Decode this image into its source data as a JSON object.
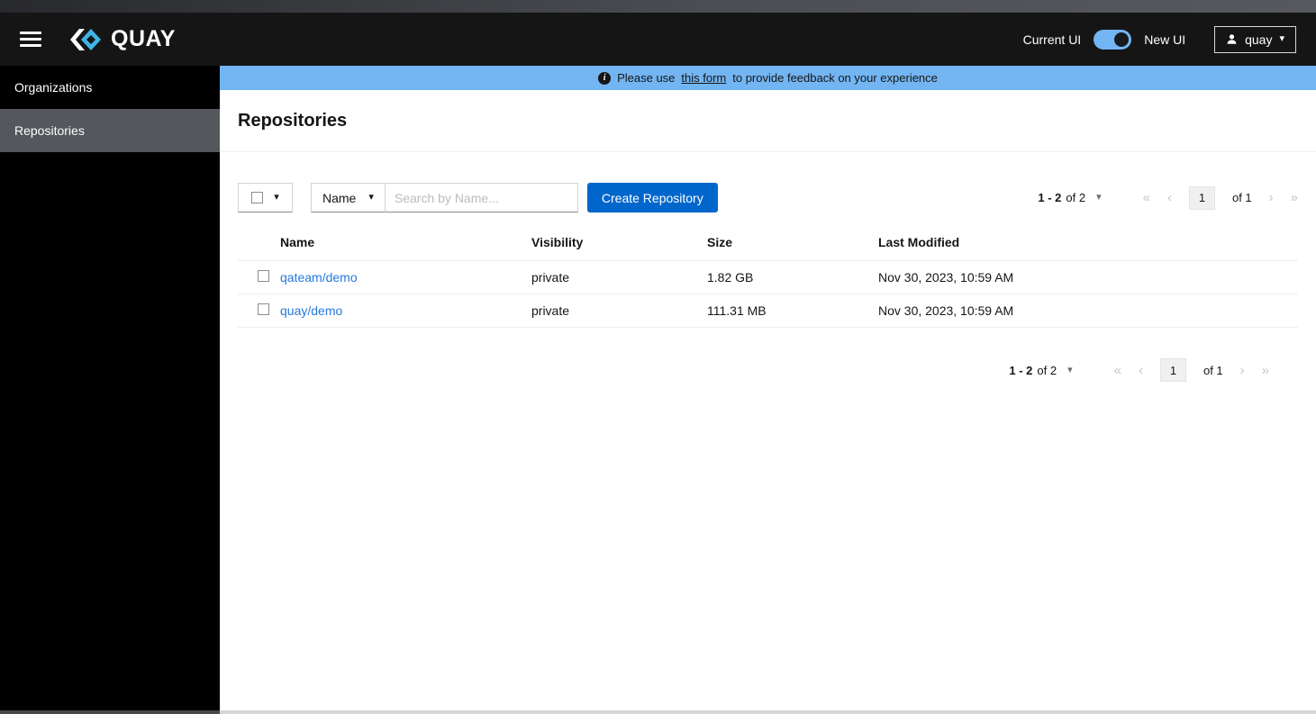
{
  "colors": {
    "accent_blue": "#0066cc",
    "banner_blue": "#73b5f2",
    "link_blue": "#2578dc",
    "masthead_bg": "#151515",
    "sidebar_active_bg": "#54575c",
    "toggle_track": "#73b5f2",
    "logo_blue": "#40b4e5"
  },
  "icons": {
    "caret_down": "▾",
    "info": "i"
  },
  "header": {
    "brand": "QUAY",
    "current_ui_label": "Current UI",
    "new_ui_label": "New UI",
    "user_name": "quay"
  },
  "sidebar": {
    "items": [
      {
        "label": "Organizations"
      },
      {
        "label": "Repositories"
      }
    ]
  },
  "banner": {
    "text_before": "Please use",
    "link_text": "this form",
    "text_after": "to provide feedback on your experience"
  },
  "page": {
    "title": "Repositories"
  },
  "toolbar": {
    "filter_label": "Name",
    "search_placeholder": "Search by Name...",
    "create_button_label": "Create Repository"
  },
  "pagination": {
    "range_current": "1 - 2",
    "range_total": "of 2",
    "page_value": "1",
    "of_pages": "of 1",
    "first_icon": "«",
    "prev_icon": "‹",
    "next_icon": "›",
    "last_icon": "»"
  },
  "table": {
    "columns": [
      "Name",
      "Visibility",
      "Size",
      "Last Modified"
    ],
    "rows": [
      {
        "name": "qateam/demo",
        "visibility": "private",
        "size": "1.82 GB",
        "last_modified": "Nov 30, 2023, 10:59 AM"
      },
      {
        "name": "quay/demo",
        "visibility": "private",
        "size": "111.31 MB",
        "last_modified": "Nov 30, 2023, 10:59 AM"
      }
    ]
  }
}
